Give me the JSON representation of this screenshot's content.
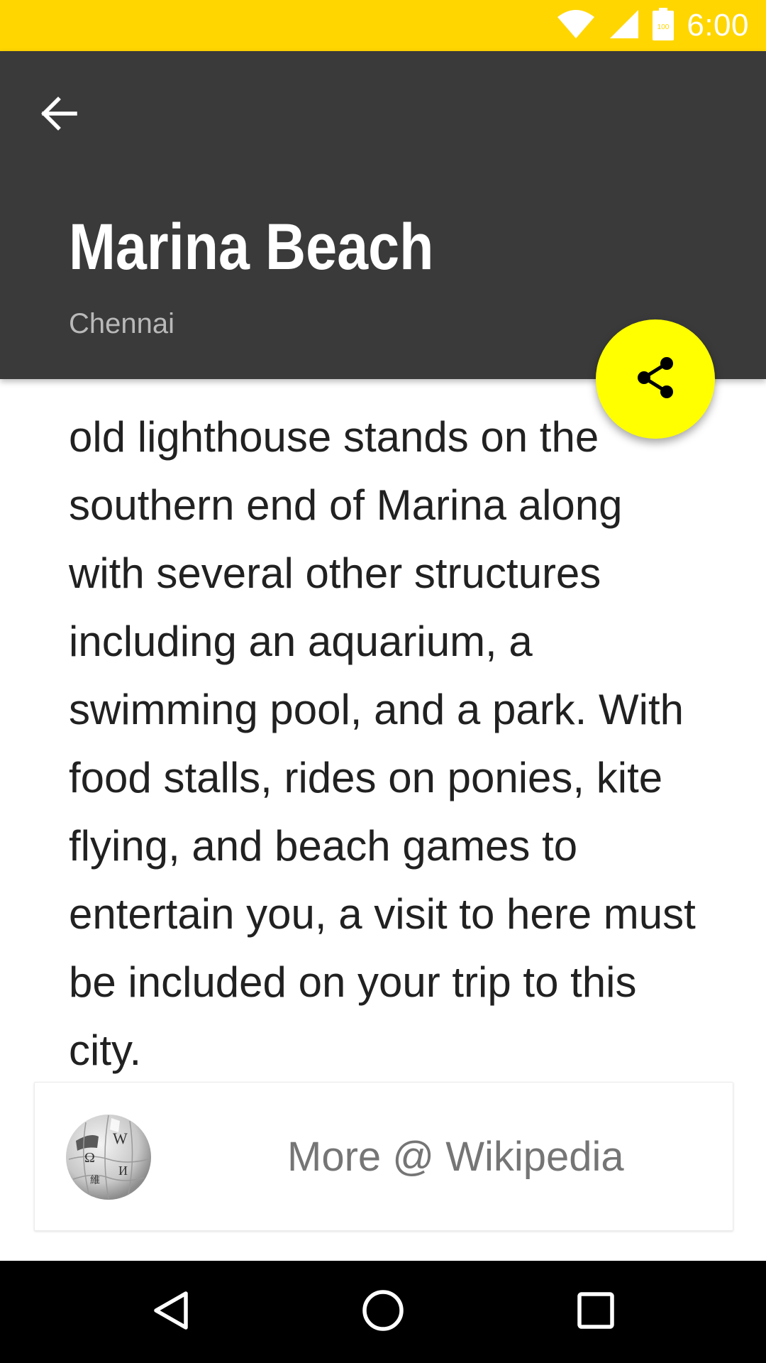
{
  "status_bar": {
    "time": "6:00",
    "battery_level": "100",
    "background_color": "#FFD600",
    "icons": [
      "wifi-icon",
      "signal-icon",
      "battery-icon"
    ]
  },
  "app_bar": {
    "back_icon": "arrow-back-icon",
    "title": "Marina Beach",
    "subtitle": "Chennai",
    "background_color": "#3A3A3A"
  },
  "fab": {
    "icon": "share-icon",
    "color": "#FFFF00"
  },
  "content": {
    "body": "old lighthouse stands on the southern end of Marina along with several other structures including an aquarium, a swimming pool, and a park. With food stalls, rides on ponies, kite flying, and beach games to entertain you, a visit to here must be included on your trip to this city."
  },
  "wiki_card": {
    "icon": "wikipedia-globe-icon",
    "label": "More @ Wikipedia"
  },
  "nav_bar": {
    "buttons": [
      "back-triangle-icon",
      "home-circle-icon",
      "recents-square-icon"
    ]
  }
}
